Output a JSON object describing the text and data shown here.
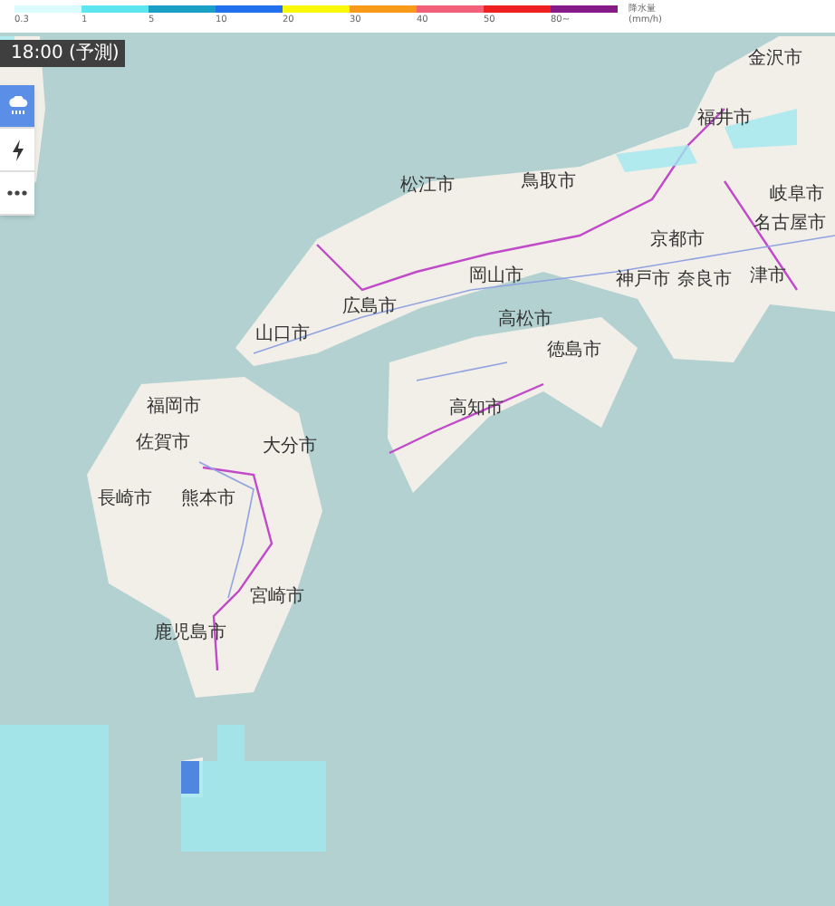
{
  "legend": {
    "items": [
      {
        "label": "0.3",
        "color": "#dcfbfd"
      },
      {
        "label": "1",
        "color": "#5ee6f0"
      },
      {
        "label": "5",
        "color": "#1aa0c4"
      },
      {
        "label": "10",
        "color": "#2370ee"
      },
      {
        "label": "20",
        "color": "#f8f808"
      },
      {
        "label": "30",
        "color": "#f79a1a"
      },
      {
        "label": "40",
        "color": "#f2607a"
      },
      {
        "label": "50",
        "color": "#ee2020"
      },
      {
        "label": "80~",
        "color": "#861a86"
      }
    ],
    "unit_title": "降水量",
    "unit": "(mm/h)"
  },
  "time_badge": "18:00 (予測)",
  "layer_buttons": [
    {
      "kind": "rain",
      "selected": true
    },
    {
      "kind": "lightning",
      "selected": false
    },
    {
      "kind": "more",
      "selected": false
    }
  ],
  "map_labels": [
    "金沢市",
    "福井市",
    "松江市",
    "鳥取市",
    "岐阜市",
    "名古屋市",
    "京都市",
    "岡山市",
    "神戸市",
    "奈良市",
    "津市",
    "広島市",
    "高松市",
    "山口市",
    "徳島市",
    "福岡市",
    "高知市",
    "佐賀市",
    "大分市",
    "長崎市",
    "熊本市",
    "宮崎市",
    "鹿児島市"
  ]
}
